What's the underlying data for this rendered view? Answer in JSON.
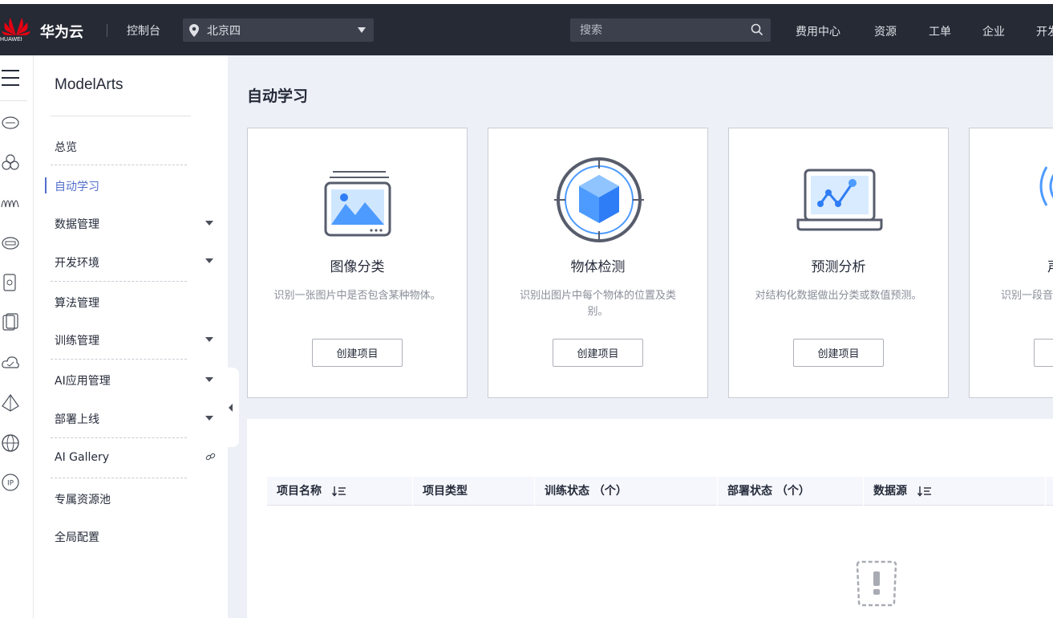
{
  "topbar": {
    "logo_word": "HUAWEI",
    "brand": "华为云",
    "console": "控制台",
    "region": "北京四",
    "search_placeholder": "搜索",
    "nav": [
      "费用中心",
      "资源",
      "工单",
      "企业",
      "开发"
    ]
  },
  "sidebar": {
    "title": "ModelArts",
    "items": [
      {
        "label": "总览"
      },
      {
        "label": "自动学习",
        "active": true
      },
      {
        "label": "数据管理",
        "expandable": true
      },
      {
        "label": "开发环境",
        "expandable": true
      },
      {
        "label": "算法管理"
      },
      {
        "label": "训练管理",
        "expandable": true
      },
      {
        "label": "AI应用管理",
        "expandable": true
      },
      {
        "label": "部署上线",
        "expandable": true
      },
      {
        "label": "AI Gallery",
        "external": true
      },
      {
        "label": "专属资源池"
      },
      {
        "label": "全局配置"
      }
    ]
  },
  "main": {
    "title": "自动学习",
    "cards": [
      {
        "title": "图像分类",
        "desc": "识别一张图片中是否包含某种物体。",
        "button": "创建项目",
        "icon": "image-classification-icon"
      },
      {
        "title": "物体检测",
        "desc": "识别出图片中每个物体的位置及类别。",
        "button": "创建项目",
        "icon": "object-detection-icon"
      },
      {
        "title": "预测分析",
        "desc": "对结构化数据做出分类或数值预测。",
        "button": "创建项目",
        "icon": "predictive-analysis-icon"
      },
      {
        "title": "声",
        "desc": "识别一段音",
        "button": "",
        "icon": "sound-classification-icon"
      }
    ],
    "table": {
      "columns": [
        "项目名称",
        "项目类型",
        "训练状态 （个）",
        "部署状态 （个）",
        "数据源"
      ]
    }
  },
  "colors": {
    "topbar": "#252a35",
    "accent": "#526ecc",
    "main_bg": "#eef0f7",
    "brand_red": "#e60012"
  }
}
